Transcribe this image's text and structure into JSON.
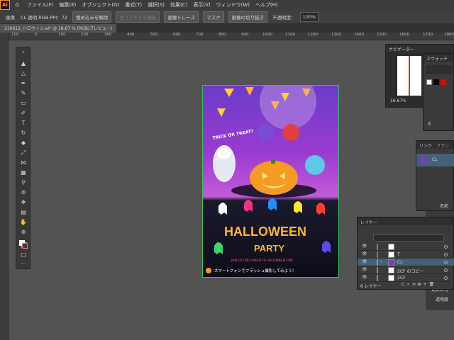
{
  "app": {
    "logo": "Ai",
    "home_icon": "home-icon"
  },
  "menu": [
    "ファイル(F)",
    "編集(E)",
    "オブジェクト(O)",
    "書式(T)",
    "選択(S)",
    "効果(C)",
    "表示(V)",
    "ウィンドウ(W)",
    "ヘルプ(H)"
  ],
  "control": {
    "label_image": "画像",
    "info": "CL 透明 RGB PPI：72",
    "embed_release": "埋め込みを解除",
    "edit_original": "オリジナルを編集",
    "image_trace": "画像トレース",
    "mask": "マスク",
    "crop": "画像の切り抜き",
    "opacity_label": "不透明度：",
    "opacity_value": "100%"
  },
  "document_tab": "210612_ハロウィン.ai* @ 18.67 % (RGB/プレビュー)",
  "ruler_top": [
    "100",
    "0",
    "100",
    "200",
    "300",
    "400",
    "500",
    "600",
    "700",
    "800",
    "900",
    "1000",
    "1100",
    "1200",
    "1300",
    "1400",
    "1500",
    "1600",
    "1700",
    "1800"
  ],
  "artboard": {
    "trick_text": "TRICK OR TREAT?",
    "title_line1": "HALLOWEEN",
    "title_line2": "PARTY",
    "subtitle": "JOIN US FOR A NIGHT OF HALLOWEEN FUN!",
    "bottom_text": "スマートフォンでフラッシュ撮影してみよう！"
  },
  "navigator": {
    "title": "ナビゲーター",
    "zoom": "16.67%"
  },
  "swatch": {
    "title": "スウォッチ"
  },
  "links": {
    "tab_links": "リンク",
    "tab_brush": "ブラシ",
    "item": "CL"
  },
  "properties": {
    "name_label": "名前",
    "linked_file": "更新日付",
    "opacity": "透明度"
  },
  "layers": {
    "title": "レイヤー",
    "search_placeholder": "",
    "rows": [
      {
        "name": "",
        "color": "#9b59ff"
      },
      {
        "name": "T",
        "color": "#7b68ee"
      },
      {
        "name": "CL",
        "color": "#3fa9f5"
      },
      {
        "name": "2CF のコピー",
        "color": "#3fbf5f"
      },
      {
        "name": "2CF",
        "color": "#3fbf5f"
      }
    ],
    "footer": "6 レイヤー"
  }
}
